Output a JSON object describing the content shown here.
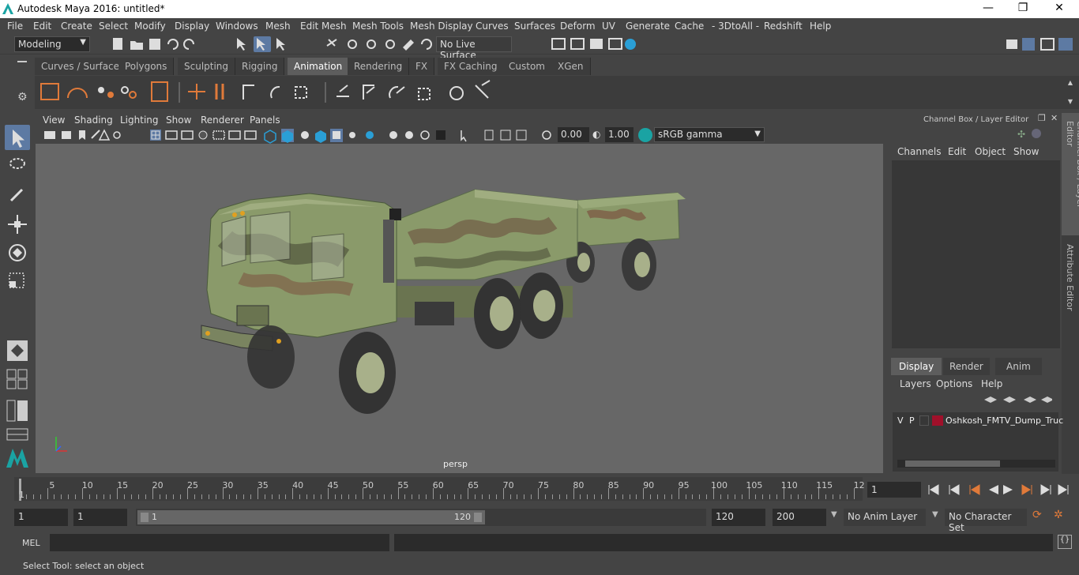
{
  "window": {
    "title": "Autodesk Maya 2016: untitled*",
    "minimize": "—",
    "restore": "❐",
    "close": "✕"
  },
  "menus": [
    "File",
    "Edit",
    "Create",
    "Select",
    "Modify",
    "Display",
    "Windows",
    "Mesh",
    "Edit Mesh",
    "Mesh Tools",
    "Mesh Display",
    "Curves",
    "Surfaces",
    "Deform",
    "UV",
    "Generate",
    "Cache",
    "- 3DtoAll -",
    "Redshift",
    "Help"
  ],
  "statusline": {
    "mode": "Modeling",
    "live_surface": "No Live Surface"
  },
  "shelf_tabs": [
    "Curves / Surfaces",
    "Polygons",
    "Sculpting",
    "Rigging",
    "Animation",
    "Rendering",
    "FX",
    "FX Caching",
    "Custom",
    "XGen"
  ],
  "active_shelf_tab": "Animation",
  "viewport": {
    "menus": [
      "View",
      "Shading",
      "Lighting",
      "Show",
      "Renderer",
      "Panels"
    ],
    "exposure": "0.00",
    "gamma": "1.00",
    "color_space": "sRGB gamma",
    "camera_label": "persp"
  },
  "channel_box": {
    "title": "Channel Box / Layer Editor",
    "menus": [
      "Channels",
      "Edit",
      "Object",
      "Show"
    ]
  },
  "right_strip": {
    "tab1": "Channel Box / Layer Editor",
    "tab2": "Attribute Editor"
  },
  "layer_editor": {
    "tabs": [
      "Display",
      "Render",
      "Anim"
    ],
    "active_tab": "Display",
    "menus": [
      "Layers",
      "Options",
      "Help"
    ],
    "layer": {
      "v": "V",
      "p": "P",
      "name": "Oshkosh_FMTV_Dump_Truc",
      "color": "#a0102a"
    }
  },
  "timeline": {
    "ticks": [
      "5",
      "10",
      "15",
      "20",
      "25",
      "30",
      "35",
      "40",
      "45",
      "50",
      "55",
      "60",
      "65",
      "70",
      "75",
      "80",
      "85",
      "90",
      "95",
      "100",
      "105",
      "110",
      "115",
      "12"
    ],
    "start_label": "1",
    "current_frame": "1"
  },
  "range": {
    "start": "1",
    "anim_start": "1",
    "slider_start": "1",
    "slider_end": "120",
    "range_end": "120",
    "anim_end": "200",
    "anim_layer": "No Anim Layer",
    "character_set": "No Character Set"
  },
  "cmdline": {
    "label": "MEL"
  },
  "helpline": {
    "text": "Select Tool: select an object"
  },
  "colors": {
    "accent": "#5d7aa3",
    "truck_camo": "#8a9a6a"
  }
}
